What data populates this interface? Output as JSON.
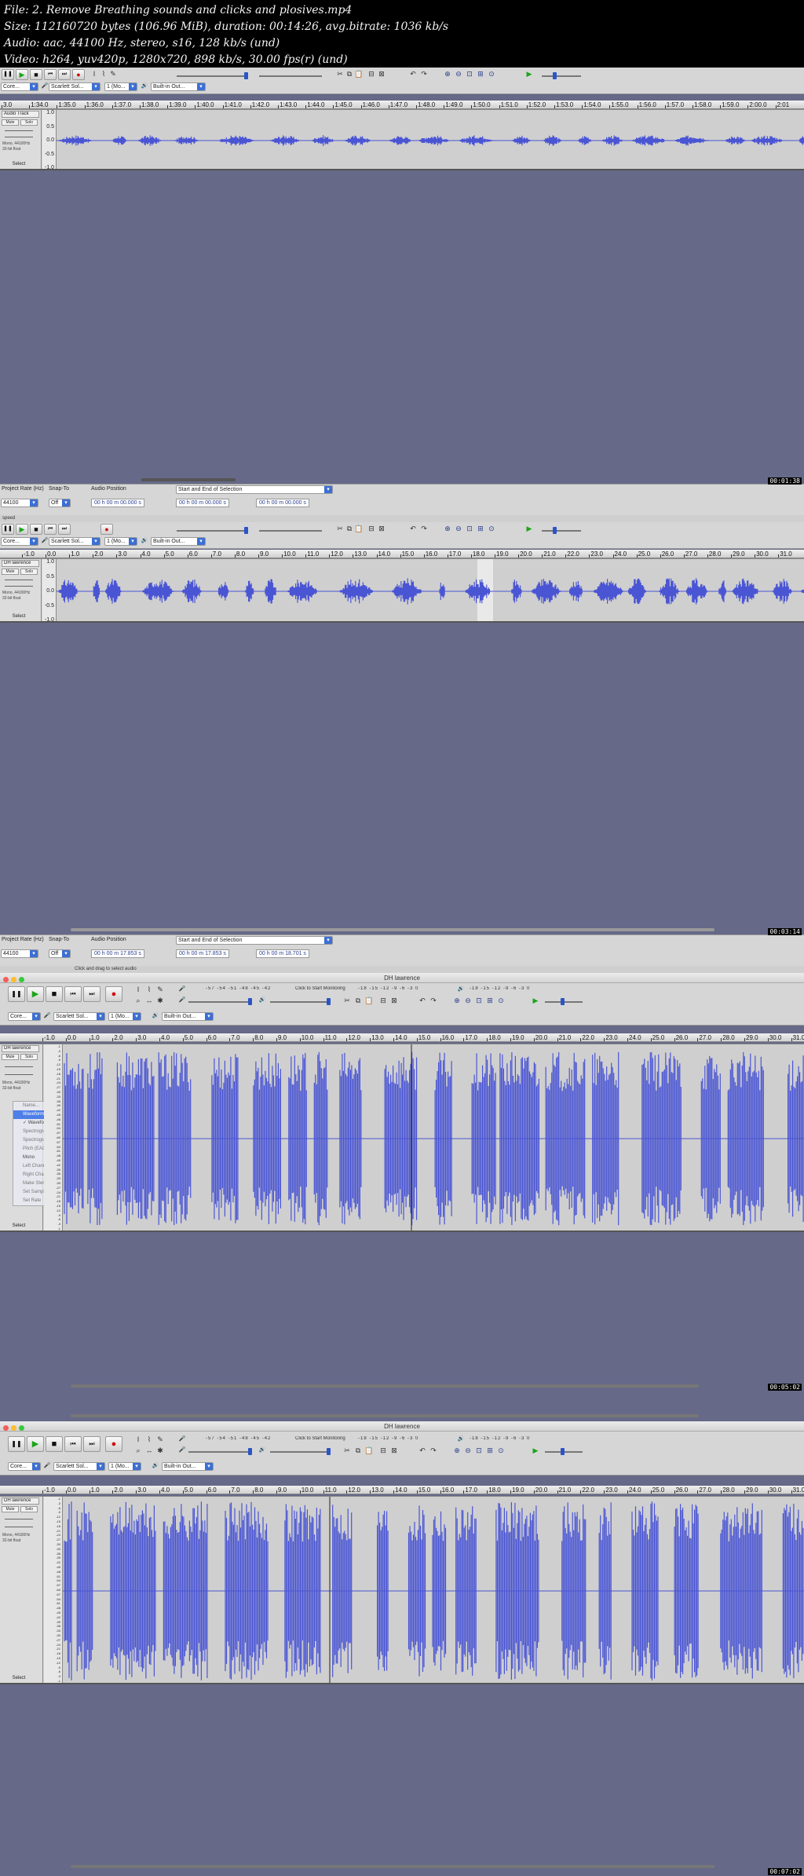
{
  "header": {
    "file": "File: 2. Remove Breathing sounds and clicks and plosives.mp4",
    "size": "Size: 112160720 bytes (106.96 MiB), duration: 00:14:26, avg.bitrate: 1036 kb/s",
    "audio": "Audio: aac, 44100 Hz, stereo, s16, 128 kb/s (und)",
    "video": "Video: h264, yuv420p, 1280x720, 898 kb/s, 30.00 fps(r) (und)"
  },
  "toolbar": {
    "pause": "❚❚",
    "play": "▶",
    "stop": "■",
    "skip_start": "⏮",
    "skip_end": "⏭",
    "record": "●",
    "host_combo": "Core...",
    "input_combo": "Scarlett Sol...",
    "channels_combo": "1 (Mo...",
    "output_combo": "Built-in Out...",
    "monitor_label": "Click to Start Monitoring",
    "meter_scale": "-57 -54 -51 -48 -45 -42",
    "meter_scale_right": "-18 -15 -12 -9 -6 -3 0",
    "icons": {
      "select": "I",
      "envelope": "⌇",
      "draw": "✎",
      "zoom": "⌕",
      "timeshift": "↔",
      "multi": "✱",
      "mic": "🎤",
      "speaker": "🔊",
      "cut": "✂",
      "copy": "⧉",
      "paste": "📋",
      "trim": "⊟",
      "silence": "⊠",
      "undo": "↶",
      "redo": "↷",
      "zoom_in": "⊕",
      "zoom_out": "⊖",
      "fit_sel": "⊡",
      "fit_proj": "⊞",
      "zoom_toggle": "⊙",
      "play_at_speed": "▶"
    }
  },
  "frame1": {
    "timestamp": "00:01:38",
    "ruler": [
      "3.0",
      "1:34.0",
      "1:35.0",
      "1:36.0",
      "1:37.0",
      "1:38.0",
      "1:39.0",
      "1:40.0",
      "1:41.0",
      "1:42.0",
      "1:43.0",
      "1:44.0",
      "1:45.0",
      "1:46.0",
      "1:47.0",
      "1:48.0",
      "1:49.0",
      "1:50.0",
      "1:51.0",
      "1:52.0",
      "1:53.0",
      "1:54.0",
      "1:55.0",
      "1:56.0",
      "1:57.0",
      "1:58.0",
      "1:59.0",
      "2:00.0",
      "2:01"
    ],
    "track_name": "Audio Track",
    "mute": "Mute",
    "solo": "Solo",
    "info": "Mono, 44100Hz\n32-bit float",
    "select": "Select",
    "scale": [
      "1.0",
      "0.5",
      "0.0",
      "-0.5",
      "-1.0"
    ]
  },
  "selection_bar": {
    "rate_label": "Project Rate (Hz)",
    "snap_label": "Snap-To",
    "pos_label": "Audio Position",
    "sel_mode": "Start and End of Selection",
    "rate_value": "44100",
    "snap_value": "Off"
  },
  "frame2": {
    "timestamp": "00:03:14",
    "pos": "00 h 00 m 00.000 s",
    "sel_start": "00 h 00 m 00.000 s",
    "sel_end": "00 h 00 m 00.000 s",
    "status": "speed",
    "ruler": [
      "-1.0",
      "0.0",
      "1.0",
      "2.0",
      "3.0",
      "4.0",
      "5.0",
      "6.0",
      "7.0",
      "8.0",
      "9.0",
      "10.0",
      "11.0",
      "12.0",
      "13.0",
      "14.0",
      "15.0",
      "16.0",
      "17.0",
      "18.0",
      "19.0",
      "20.0",
      "21.0",
      "22.0",
      "23.0",
      "24.0",
      "25.0",
      "26.0",
      "27.0",
      "28.0",
      "29.0",
      "30.0",
      "31.0"
    ],
    "track_name": "DH lawrence",
    "mute": "Mute",
    "solo": "Solo",
    "info": "Mono, 44100Hz\n32-bit float",
    "select": "Select",
    "scale": [
      "1.0",
      "0.5",
      "0.0",
      "-0.5",
      "-1.0"
    ]
  },
  "frame3": {
    "timestamp": "00:05:02",
    "pos": "00 h 00 m 17.853 s",
    "sel_start": "00 h 00 m 17.853 s",
    "sel_end": "00 h 00 m 18.701 s",
    "status": "Click and drag to select audio",
    "window_title": "DH lawrence",
    "ruler": [
      "-1.0",
      "0.0",
      "1.0",
      "2.0",
      "3.0",
      "4.0",
      "5.0",
      "6.0",
      "7.0",
      "8.0",
      "9.0",
      "10.0",
      "11.0",
      "12.0",
      "13.0",
      "14.0",
      "15.0",
      "16.0",
      "17.0",
      "18.0",
      "19.0",
      "20.0",
      "21.0",
      "22.0",
      "23.0",
      "24.0",
      "25.0",
      "26.0",
      "27.0",
      "28.0",
      "29.0",
      "30.0",
      "31.0"
    ],
    "track_name": "DH lawrence",
    "mute": "Mute",
    "solo": "Solo",
    "info": "Mono, 44100Hz\n32-bit float",
    "select": "Select",
    "scale": [
      "-1",
      "-3",
      "-6",
      "-9",
      "-12",
      "-15",
      "-18",
      "-21",
      "-24",
      "-27",
      "-30",
      "-33",
      "-36",
      "-39",
      "-42",
      "-45",
      "-48",
      "-51",
      "-54",
      "-57",
      "-60",
      "-57",
      "-54",
      "-51",
      "-48",
      "-45",
      "-42",
      "-39",
      "-36",
      "-33",
      "-30",
      "-27",
      "-24",
      "-21",
      "-18",
      "-15",
      "-12",
      "-9",
      "-6",
      "-3",
      "-1"
    ],
    "menu": [
      "Name...",
      "Waveform",
      "✓ Waveform (dB)",
      "Spectrogram",
      "Spectrogram log(f)",
      "Pitch (EAC)",
      "Mono",
      "Left Channel",
      "Right Channel",
      "Make Stereo Track",
      "Set Sample Format",
      "Set Rate"
    ]
  },
  "frame4": {
    "timestamp": "00:07:02",
    "window_title": "DH lawrence",
    "ruler": [
      "-1.0",
      "0.0",
      "1.0",
      "2.0",
      "3.0",
      "4.0",
      "5.0",
      "6.0",
      "7.0",
      "8.0",
      "9.0",
      "10.0",
      "11.0",
      "12.0",
      "13.0",
      "14.0",
      "15.0",
      "16.0",
      "17.0",
      "18.0",
      "19.0",
      "20.0",
      "21.0",
      "22.0",
      "23.0",
      "24.0",
      "25.0",
      "26.0",
      "27.0",
      "28.0",
      "29.0",
      "30.0",
      "31.0"
    ],
    "track_name": "DH lawrence",
    "mute": "Mute",
    "solo": "Solo",
    "info": "Mono, 44100Hz\n32-bit float",
    "select": "Select",
    "scale": [
      "-1",
      "-3",
      "-6",
      "-9",
      "-12",
      "-15",
      "-18",
      "-21",
      "-24",
      "-27",
      "-30",
      "-33",
      "-36",
      "-39",
      "-42",
      "-45",
      "-48",
      "-51",
      "-54",
      "-57",
      "-60",
      "-57",
      "-54",
      "-51",
      "-48",
      "-45",
      "-42",
      "-39",
      "-36",
      "-33",
      "-30",
      "-27",
      "-24",
      "-21",
      "-18",
      "-15",
      "-12",
      "-9",
      "-6",
      "-3",
      "-1"
    ]
  },
  "colors": {
    "waveform": "#4a55d4",
    "waveform_dark": "#3a3fb8",
    "background": "#666988"
  }
}
